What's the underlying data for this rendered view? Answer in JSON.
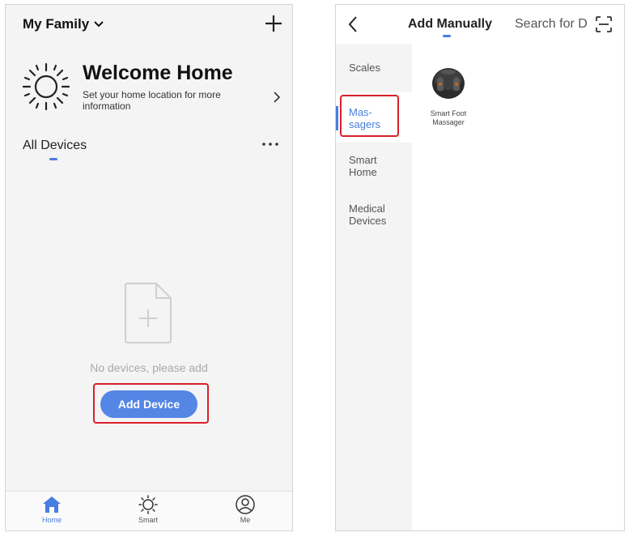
{
  "left": {
    "header": {
      "family_name": "My Family"
    },
    "welcome": {
      "title": "Welcome Home",
      "subtitle": "Set your home location for more information"
    },
    "devices": {
      "section_title": "All Devices"
    },
    "empty": {
      "message": "No devices, please add",
      "add_button": "Add Device"
    },
    "tabbar": {
      "tabs": [
        {
          "label": "Home",
          "icon": "home-icon",
          "active": true
        },
        {
          "label": "Smart",
          "icon": "sun-icon",
          "active": false
        },
        {
          "label": "Me",
          "icon": "profile-icon",
          "active": false
        }
      ]
    }
  },
  "right": {
    "header": {
      "title": "Add Manually",
      "search_label": "Search for D"
    },
    "categories": [
      {
        "label": "Scales",
        "active": false
      },
      {
        "label": "Mas-\nsagers",
        "active": true
      },
      {
        "label": "Smart\nHome",
        "active": false
      },
      {
        "label": "Medical\nDevices",
        "active": false
      }
    ],
    "devices": [
      {
        "name": "Smart Foot Massager",
        "icon": "foot-massager-image"
      }
    ]
  },
  "colors": {
    "accent": "#4a7de0",
    "button": "#5486e6",
    "highlight_box": "#d9202a",
    "background": "#f4f4f4"
  }
}
